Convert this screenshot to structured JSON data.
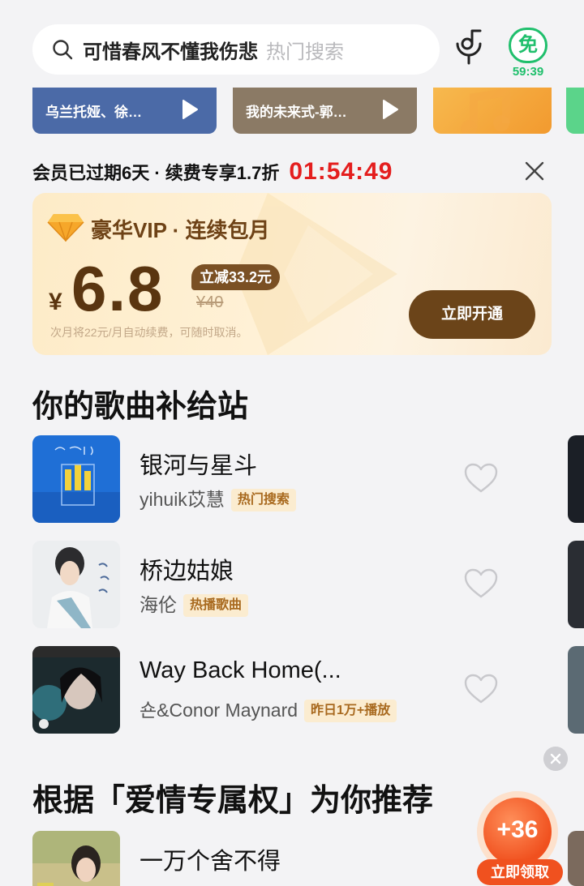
{
  "search": {
    "query": "可惜春风不懂我伤悲",
    "hint": "热门搜索"
  },
  "free_badge": {
    "label": "免",
    "timer": "59:39"
  },
  "banners": [
    {
      "text": "乌兰托娅、徐…"
    },
    {
      "text": "我的未来式-郭…"
    }
  ],
  "membership": {
    "text": "会员已过期6天 · 续费专享1.7折",
    "countdown": "01:54:49"
  },
  "vip_card": {
    "title": "豪华VIP · 连续包月",
    "currency": "¥",
    "price": "6.8",
    "discount": "立减33.2元",
    "original_price": "¥40",
    "note": "次月将22元/月自动续费，可随时取消。",
    "button": "立即开通"
  },
  "section1": {
    "title": "你的歌曲补给站",
    "songs": [
      {
        "name": "银河与星斗",
        "artist": "yihuik苡慧",
        "tag": "热门搜索"
      },
      {
        "name": "桥边姑娘",
        "artist": "海伦",
        "tag": "热播歌曲"
      },
      {
        "name": "Way Back Home(...",
        "artist": "숀&Conor Maynard",
        "tag": "昨日1万+播放"
      }
    ]
  },
  "section2": {
    "title": "根据「爱情专属权」为你推荐",
    "songs": [
      {
        "name": "一万个舍不得",
        "artist": "",
        "tag": ""
      }
    ]
  },
  "reward": {
    "amount": "+36",
    "button": "立即领取"
  },
  "colors": {
    "accent_green": "#1fbf6c",
    "countdown_red": "#e41e1e",
    "vip_brown": "#6b4419",
    "reward_orange": "#f0511f"
  }
}
